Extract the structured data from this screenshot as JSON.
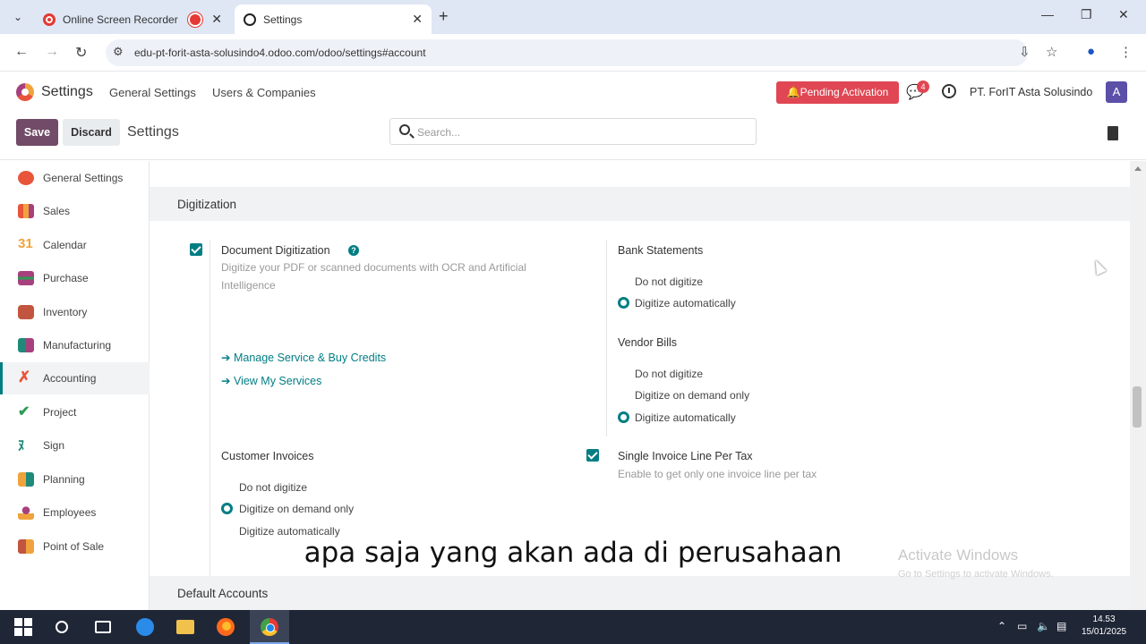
{
  "browser": {
    "tabs": [
      {
        "title": "Online Screen Recorder"
      },
      {
        "title": "Settings"
      }
    ],
    "url": "edu-pt-forit-asta-solusindo4.odoo.com/odoo/settings#account"
  },
  "navbar": {
    "app_name": "Settings",
    "menus": [
      "General Settings",
      "Users & Companies"
    ],
    "pending_label": "Pending Activation",
    "chat_count": "4",
    "company": "PT. ForIT Asta Solusindo",
    "avatar_letter": "A"
  },
  "control_panel": {
    "save_label": "Save",
    "discard_label": "Discard",
    "title": "Settings",
    "search_placeholder": "Search..."
  },
  "sidebar": {
    "items": [
      {
        "label": "General Settings",
        "icon": "odoo-icon",
        "color": "#e8553b"
      },
      {
        "label": "Sales",
        "icon": "sales-icon",
        "color": "#f0a33c"
      },
      {
        "label": "Calendar",
        "icon": "calendar-icon",
        "color": "#f0a33c"
      },
      {
        "label": "Purchase",
        "icon": "purchase-icon",
        "color": "#a6417d"
      },
      {
        "label": "Inventory",
        "icon": "inventory-icon",
        "color": "#c2553f"
      },
      {
        "label": "Manufacturing",
        "icon": "manufacturing-icon",
        "color": "#1f8a7a"
      },
      {
        "label": "Accounting",
        "icon": "accounting-icon",
        "color": "#e8553b"
      },
      {
        "label": "Project",
        "icon": "project-icon",
        "color": "#2d9a55"
      },
      {
        "label": "Sign",
        "icon": "sign-icon",
        "color": "#1f8a7a"
      },
      {
        "label": "Planning",
        "icon": "planning-icon",
        "color": "#f0a33c"
      },
      {
        "label": "Employees",
        "icon": "employees-icon",
        "color": "#a6417d"
      },
      {
        "label": "Point of Sale",
        "icon": "pos-icon",
        "color": "#c2553f"
      }
    ],
    "active": "Accounting"
  },
  "main": {
    "section_title": "Digitization",
    "doc_digitization": {
      "title": "Document Digitization",
      "desc_line1": "Digitize your PDF or scanned documents with OCR and Artificial",
      "desc_line2": "Intelligence",
      "checked": true
    },
    "links": [
      "Manage Service & Buy Credits",
      "View My Services"
    ],
    "bank_statements": {
      "title": "Bank Statements",
      "options": [
        "Do not digitize",
        "Digitize automatically"
      ],
      "selected": "Digitize automatically"
    },
    "vendor_bills": {
      "title": "Vendor Bills",
      "options": [
        "Do not digitize",
        "Digitize on demand only",
        "Digitize automatically"
      ],
      "selected": "Digitize automatically"
    },
    "customer_invoices": {
      "title": "Customer Invoices",
      "options": [
        "Do not digitize",
        "Digitize on demand only",
        "Digitize automatically"
      ],
      "selected": "Digitize on demand only"
    },
    "single_invoice_line": {
      "title": "Single Invoice Line Per Tax",
      "desc": "Enable to get only one invoice line per tax",
      "checked": true
    },
    "next_section_title": "Default Accounts"
  },
  "overlay": {
    "caption": "apa saja yang akan ada di perusahaan",
    "watermark_title": "Activate Windows",
    "watermark_sub": "Go to Settings to activate Windows."
  },
  "taskbar": {
    "time": "14.53",
    "date": "15/01/2025"
  }
}
